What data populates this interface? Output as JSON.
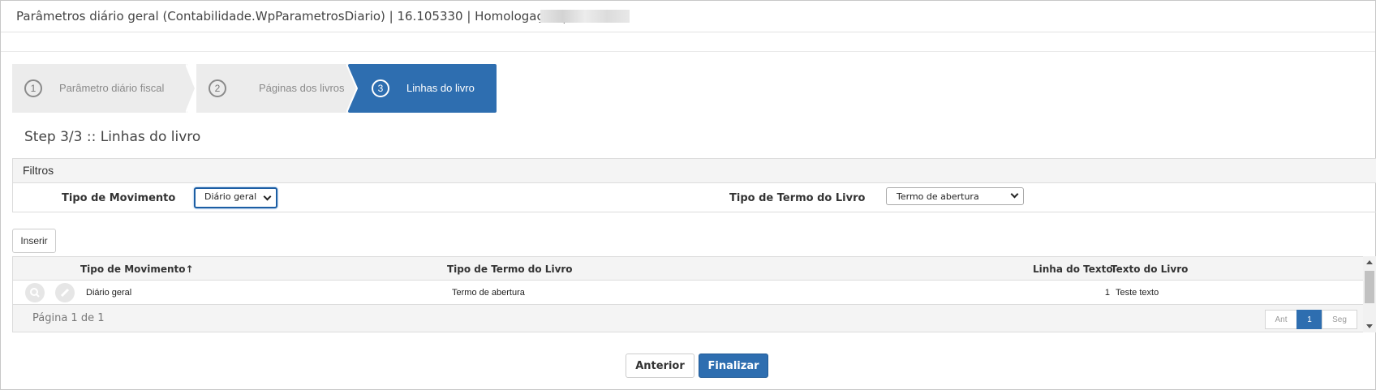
{
  "window": {
    "title": "Parâmetros diário geral (Contabilidade.WpParametrosDiario) | 16.105330 | Homologação |"
  },
  "wizard": {
    "steps": [
      {
        "number": "1",
        "label": "Parâmetro diário fiscal",
        "active": false
      },
      {
        "number": "2",
        "label": "Páginas dos livros",
        "active": false
      },
      {
        "number": "3",
        "label": "Linhas do livro",
        "active": true
      }
    ],
    "active_color": "#2e6eb0"
  },
  "step_title": "Step 3/3 :: Linhas do livro",
  "filters": {
    "title": "Filtros",
    "tipo_movimento": {
      "label": "Tipo de Movimento",
      "value": "Diário geral"
    },
    "tipo_termo": {
      "label": "Tipo de Termo do Livro",
      "value": "Termo de abertura"
    }
  },
  "toolbar": {
    "insert_label": "Inserir"
  },
  "grid": {
    "columns": [
      "Tipo de Movimento",
      "Tipo de Termo do Livro",
      "Linha do Texto",
      "Texto do Livro"
    ],
    "sort_indicator": "↑",
    "rows": [
      {
        "tipo_movimento": "Diário geral",
        "tipo_termo": "Termo de abertura",
        "linha": "1",
        "texto": "Teste texto"
      }
    ],
    "icons": [
      "search-icon",
      "edit-icon"
    ],
    "page_info": "Página 1 de 1",
    "pager": {
      "prev": "Ant",
      "current": "1",
      "next": "Seg"
    }
  },
  "footer": {
    "prev_label": "Anterior",
    "finish_label": "Finalizar"
  }
}
